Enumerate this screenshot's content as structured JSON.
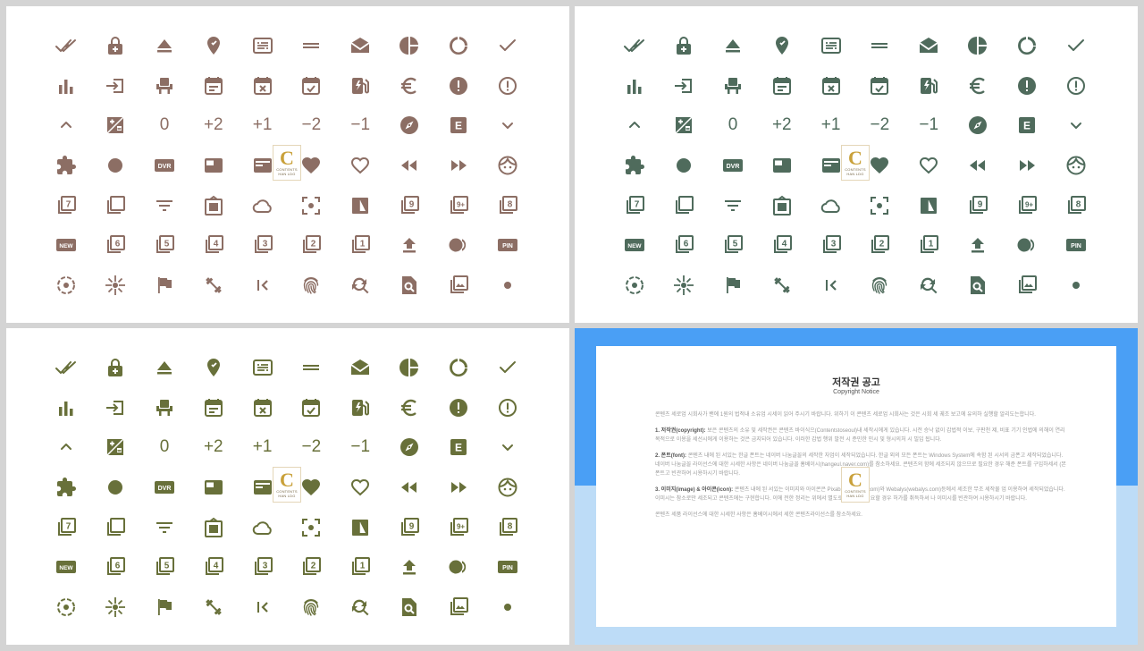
{
  "panels": [
    {
      "id": "brown",
      "color": "#8c6e64"
    },
    {
      "id": "green",
      "color": "#4f6b5c"
    },
    {
      "id": "olive",
      "color": "#68703a"
    }
  ],
  "numeric_labels": {
    "zero": "0",
    "plus2": "+2",
    "plus1": "+1",
    "minus2": "−2",
    "minus1": "−1"
  },
  "badges": {
    "dvr": "DVR",
    "new": "NEW",
    "pin": "PIN",
    "e": "E",
    "n7": "7",
    "n9": "9",
    "n9plus": "9+",
    "n8": "8",
    "n6": "6",
    "n5": "5",
    "n4": "4",
    "n3": "3",
    "n2": "2",
    "n1": "1"
  },
  "icons": [
    [
      "done-all-icon",
      "lock-add-icon",
      "eject-icon",
      "location-icon",
      "subtitles-icon",
      "drag-handle-icon",
      "drafts-icon",
      "pie-chart-icon",
      "data-usage-icon",
      "check-icon"
    ],
    [
      "bar-chart-icon",
      "input-icon",
      "event-seat-icon",
      "calendar-icon",
      "calendar-cancel-icon",
      "calendar-check-icon",
      "ev-station-icon",
      "euro-icon",
      "error-filled-icon",
      "error-outline-icon"
    ],
    [
      "chevron-up-icon",
      "exposure-icon",
      "exposure-zero-icon",
      "exposure-plus2-icon",
      "exposure-plus1-icon",
      "exposure-minus2-icon",
      "exposure-minus1-icon",
      "explore-icon",
      "e-badge-icon",
      "chevron-down-icon"
    ],
    [
      "extension-icon",
      "circle-icon",
      "dvr-icon",
      "featured-video-icon",
      "featured-video-2-icon",
      "heart-icon",
      "heart-outline-icon",
      "fast-rewind-icon",
      "fast-forward-icon",
      "face-icon"
    ],
    [
      "filter-7-icon",
      "filter-none-icon",
      "filter-list-icon",
      "filter-frames-icon",
      "cloud-icon",
      "center-focus-icon",
      "filter-b-w-icon",
      "filter-9-icon",
      "filter-9-plus-icon",
      "filter-8-icon"
    ],
    [
      "fiber-new-icon",
      "filter-6-icon",
      "filter-5-icon",
      "filter-4-icon",
      "filter-3-icon",
      "filter-2-icon",
      "filter-1-icon",
      "file-upload-icon",
      "fiber-smart-record-icon",
      "fiber-pin-icon"
    ],
    [
      "filter-tilt-shift-icon",
      "flare-icon",
      "flag-icon",
      "fitness-icon",
      "first-page-icon",
      "fingerprint-icon",
      "find-replace-icon",
      "find-in-page-icon",
      "filter-photo-icon",
      "dot-icon"
    ]
  ],
  "logo": {
    "letter": "C",
    "line1": "CONTENTS",
    "line2": "HAN LDG"
  },
  "notice": {
    "title": "저작권 공고",
    "subtitle": "Copyright Notice",
    "intro": "콘텐츠 세로업 시회사가 밴에 1원의 법적내 소유업 시세이 읽어 주시기 바랍니다. 위하기 이 콘텐츠 세로업 시회사는 것은 시회 세 궤조 보고에 유의하 실행할 알리도는합니다.",
    "s1_head": "1. 저작권(copyright):",
    "s1_body": "보은 콘텐츠의 소유 및 세작권은 콘텐츠 바이식으(Contentstoseoul)내 세작시에게 있습니다. 시전 승낙 없이 갑법적 이보, 구판천 제, 비표 기기 인법에 의해이 연리 목적으로 이용을 세선시에게 이용하는 것은 금지되어 있습니다. 이러한 갑법 행위 발전 시 준민한 민시 및 형시의처 시 빌입 됩니다.",
    "s2_head": "2. 폰트(font):",
    "s2_body": "콘텐츠 내에 된 서있는 한글 폰트는 네이버 나눔글꼴의 세작한 자엄이 세작되었습니다. 한글 외의 모든 폰트는 Windows System에 속함 된 시서의 금폰고 세작되었습니다. 네이버 나눔글꼴 라이선스에 대한 시세한 사항은 네이버 나눔글꼴 홈베이시(hangeul.naver.com)를 참소하세요. 콘텐츠의 함에 세조되지 않으므로 필요한 경우 해준 폰트를 구입하세서 (본 폰트고 빈관하여 시용하시기 바랍니다.",
    "s3_head": "3. 이미지(image) & 아이콘(icon):",
    "s3_body": "콘텐츠 내에 된 서있는 이미지와 아이콘은 Pixabay(pixabay.com)와 Webalys(webalys.com)등에서 세조한 무조 세작물 업 이용하여 세작되었습니다. 이미시는 참소로만 세조되고 콘텐츠에는 구현합니다. 이에 전한 정리는 위에서 별도로 확인하고 필요할 경우 허가를 취득하셔 나 이미시를 빈관하여 시용하시기 바랍니다.",
    "footer": "콘텐츠 세품 라이선스에 대한 시세한 사항은 홈베이시에서 세한 콘텐츠라이선스를 참소하세요."
  }
}
